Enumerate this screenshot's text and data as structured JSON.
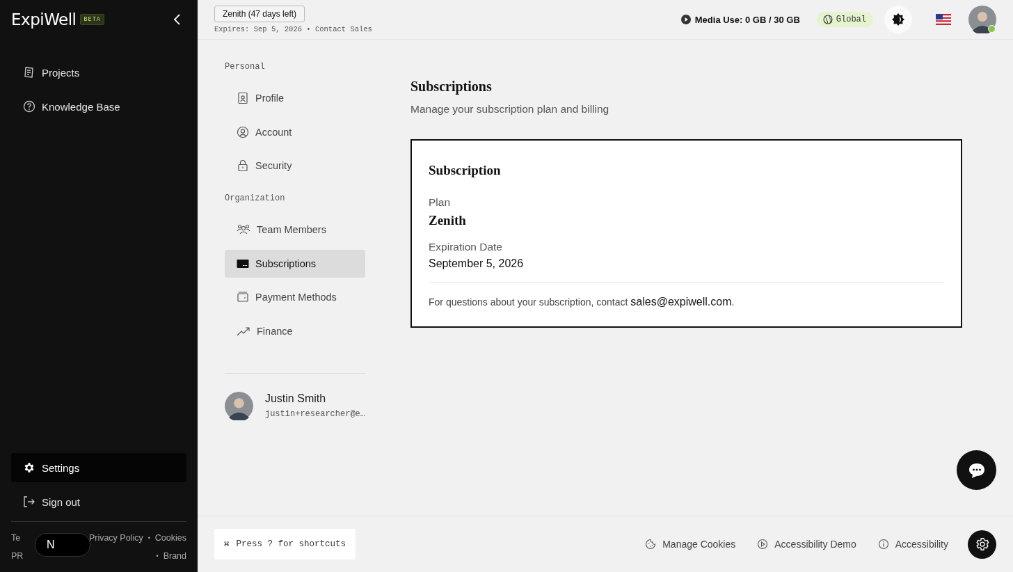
{
  "sidebar": {
    "logo": "ExpiWell",
    "badge": "BETA",
    "nav": [
      {
        "label": "Projects",
        "kind": "document",
        "selected": false
      },
      {
        "label": "Knowledge Base",
        "kind": "help",
        "selected": false
      }
    ],
    "bottom_nav": [
      {
        "label": "Settings",
        "kind": "gear",
        "selected": true
      },
      {
        "label": "Sign out",
        "kind": "exit",
        "selected": false
      }
    ],
    "footer_lines": [
      {
        "start": "Te",
        "links": [
          "Privacy Policy",
          "•",
          "Cookies"
        ]
      },
      {
        "start": "PR",
        "links": [
          "•",
          "Brand"
        ]
      }
    ],
    "dev_badge": "N"
  },
  "topbar": {
    "plan_button": "Zenith (47 days left)",
    "expires": "Expires: Sep 5, 2026",
    "separator": "•",
    "contact": "Contact Sales",
    "media_use": "Media Use: 0 GB / 30 GB",
    "region": "Global",
    "user_online": true
  },
  "settings_nav": {
    "groups": [
      {
        "heading": "Personal",
        "items": [
          {
            "label": "Profile",
            "kind": "profile",
            "selected": false
          },
          {
            "label": "Account",
            "kind": "account",
            "selected": false
          },
          {
            "label": "Security",
            "kind": "lock",
            "selected": false
          }
        ]
      },
      {
        "heading": "Organization",
        "items": [
          {
            "label": "Team Members",
            "kind": "team",
            "selected": false
          },
          {
            "label": "Subscriptions",
            "kind": "card",
            "selected": true
          },
          {
            "label": "Payment Methods",
            "kind": "wallet",
            "selected": false
          },
          {
            "label": "Finance",
            "kind": "trend",
            "selected": false
          }
        ]
      }
    ],
    "user": {
      "name": "Justin Smith",
      "email": "justin+researcher@e…"
    }
  },
  "page": {
    "title": "Subscriptions",
    "subtitle": "Manage your subscription plan and billing",
    "card": {
      "title": "Subscription",
      "fields": [
        {
          "label": "Plan",
          "value": "Zenith",
          "kind": "emphasis"
        },
        {
          "label": "Expiration Date",
          "value": "September 5, 2026",
          "kind": "plain"
        }
      ],
      "note": "For questions about your subscription, contact ",
      "email": "sales@expiwell.com",
      "note_end": "."
    }
  },
  "footer": {
    "shortcut_key": "⌘",
    "shortcut": "Press ? for shortcuts",
    "links": [
      {
        "label": "Manage Cookies",
        "kind": "cookie"
      },
      {
        "label": "Accessibility Demo",
        "kind": "play"
      },
      {
        "label": "Accessibility",
        "kind": "info"
      }
    ]
  }
}
